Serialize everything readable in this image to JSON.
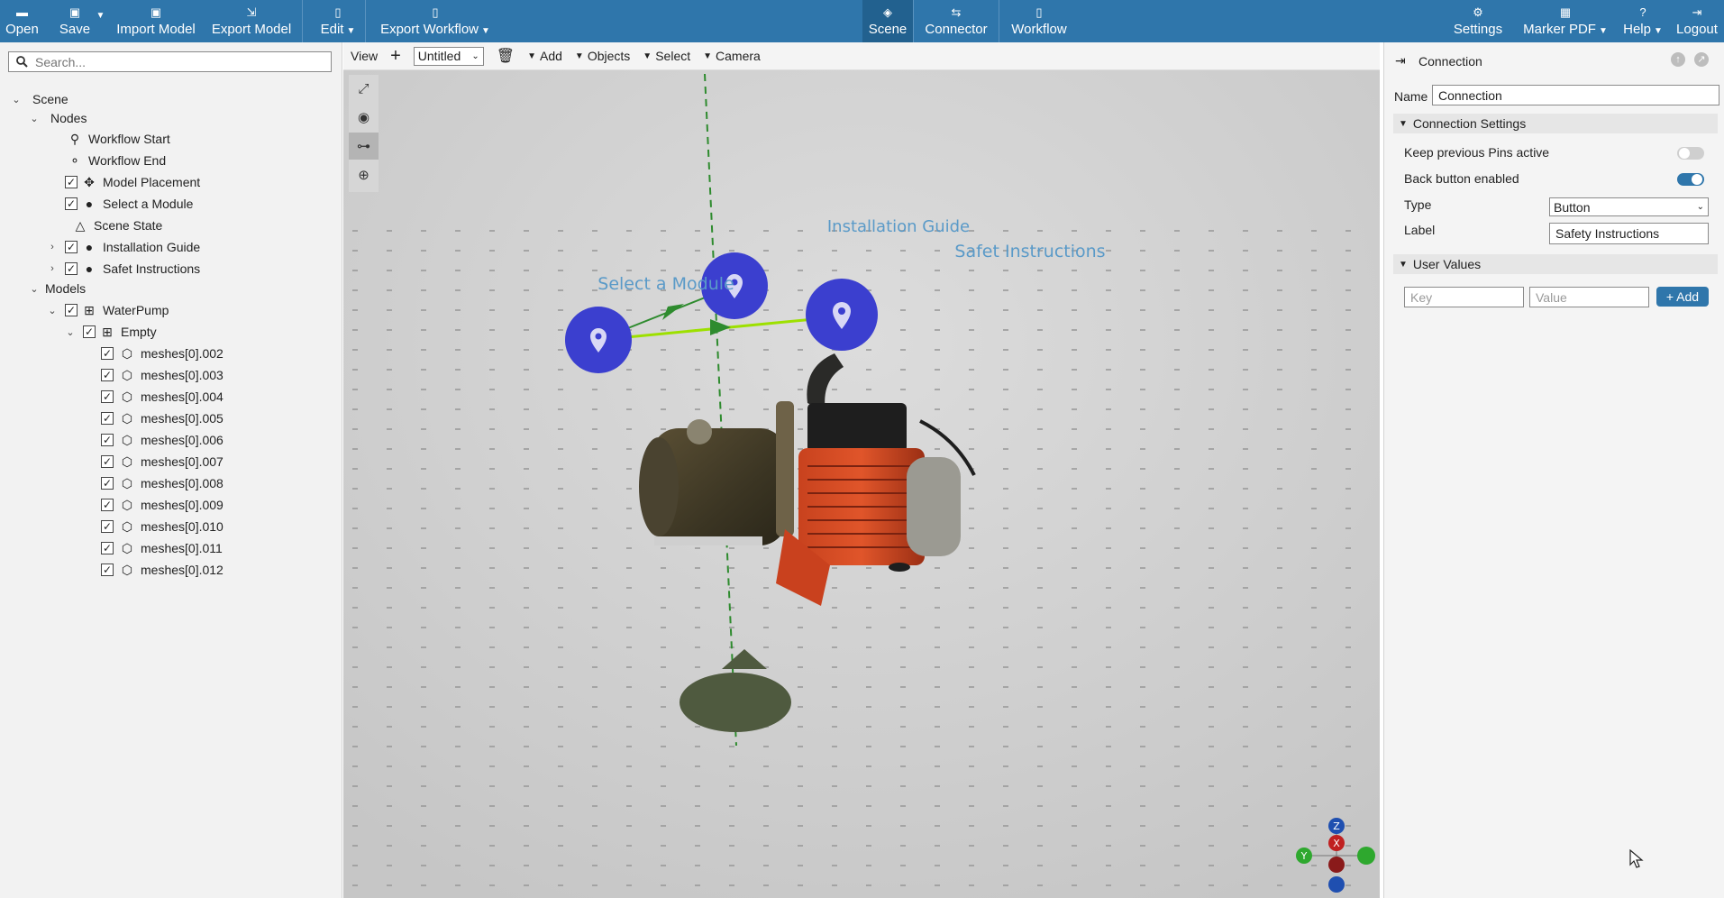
{
  "toolbar": {
    "open": "Open",
    "save": "Save",
    "import_model": "Import Model",
    "export_model": "Export Model",
    "edit": "Edit",
    "export_workflow": "Export Workflow",
    "scene": "Scene",
    "connector": "Connector",
    "workflow": "Workflow",
    "settings": "Settings",
    "marker_pdf": "Marker PDF",
    "help": "Help",
    "logout": "Logout",
    "colors": {
      "bar": "#2f76ab",
      "active_tab": "#22618f"
    }
  },
  "search": {
    "placeholder": "Search..."
  },
  "tree": {
    "scene": "Scene",
    "nodes": "Nodes",
    "workflow_start": "Workflow Start",
    "workflow_end": "Workflow End",
    "model_placement": "Model Placement",
    "select_module": "Select a Module",
    "scene_state": "Scene State",
    "installation_guide": "Installation Guide",
    "safet_instructions": "Safet Instructions",
    "models": "Models",
    "waterpump": "WaterPump",
    "empty": "Empty",
    "meshes": [
      "meshes[0].002",
      "meshes[0].003",
      "meshes[0].004",
      "meshes[0].005",
      "meshes[0].006",
      "meshes[0].007",
      "meshes[0].008",
      "meshes[0].009",
      "meshes[0].010",
      "meshes[0].011",
      "meshes[0].012"
    ]
  },
  "viewport": {
    "view": "View",
    "untitled": "Untitled",
    "add": "Add",
    "objects": "Objects",
    "select": "Select",
    "camera": "Camera",
    "pins": {
      "select_module": "Select a Module",
      "installation_guide": "Installation Guide",
      "safet_instructions": "Safet Instructions"
    },
    "axes": {
      "z": "Z",
      "x": "X",
      "y": "Y"
    },
    "colors": {
      "pin": "#3b3fcf",
      "connector": "#9de000",
      "dashed": "#2e8b2e",
      "axis_x": "#c02020",
      "axis_y": "#2ea82e",
      "axis_z": "#1f4fb0"
    }
  },
  "panel": {
    "title": "Connection",
    "name_label": "Name",
    "name_value": "Connection",
    "connection_settings": "Connection Settings",
    "keep_pins": "Keep previous Pins active",
    "keep_pins_on": false,
    "back_button": "Back button enabled",
    "back_button_on": true,
    "type_label": "Type",
    "type_value": "Button",
    "label_label": "Label",
    "label_value": "Safety Instructions",
    "user_values": "User Values",
    "key_placeholder": "Key",
    "value_placeholder": "Value",
    "add": "+ Add"
  }
}
